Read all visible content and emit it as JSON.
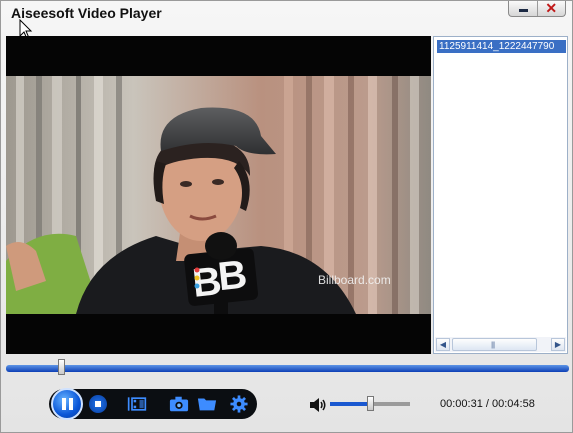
{
  "window": {
    "title": "Aiseesoft Video Player"
  },
  "video": {
    "watermark": "Billboard.com"
  },
  "playlist": {
    "items": [
      {
        "label": "1125911414_1222447790"
      }
    ]
  },
  "playback": {
    "progress_fraction": 0.0985,
    "elapsed": "00:00:31",
    "separator": " / ",
    "duration": "00:04:58",
    "volume_fraction": 0.5
  },
  "icons": {
    "minimize": "minimize-icon",
    "close": "close-icon",
    "play_pause": "pause-icon",
    "stop": "stop-icon",
    "video": "film-icon",
    "snapshot": "camera-icon",
    "open": "folder-icon",
    "settings": "gear-icon",
    "volume": "speaker-icon"
  },
  "colors": {
    "accent": "#1a58d0",
    "selection": "#3a6fc4",
    "close": "#c01818"
  }
}
